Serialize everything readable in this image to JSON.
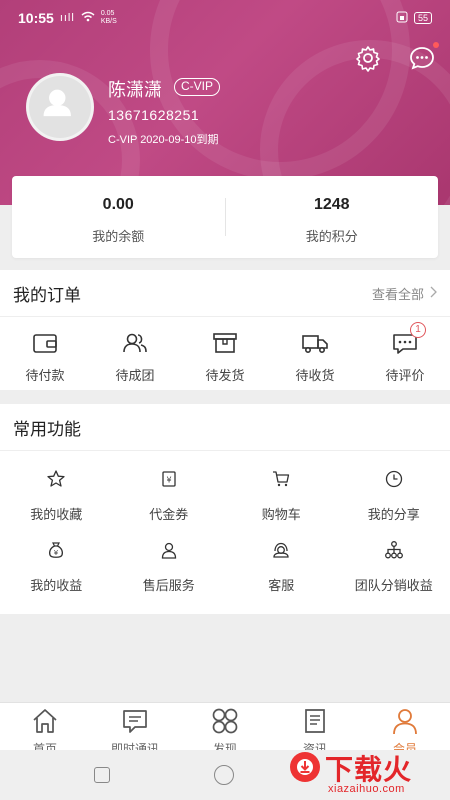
{
  "status_bar": {
    "time": "10:55",
    "signal": "ııll",
    "speed": "0.05\nKB/S",
    "battery": "55"
  },
  "profile": {
    "name": "陈潇潇",
    "vip_badge": "C-VIP",
    "phone": "13671628251",
    "expiry": "C-VIP 2020-09-10到期"
  },
  "balance": {
    "amount_value": "0.00",
    "amount_label": "我的余额",
    "points_value": "1248",
    "points_label": "我的积分"
  },
  "orders": {
    "title": "我的订单",
    "view_all": "查看全部",
    "items": [
      {
        "label": "待付款",
        "icon": "wallet-icon"
      },
      {
        "label": "待成团",
        "icon": "group-icon"
      },
      {
        "label": "待发货",
        "icon": "box-icon"
      },
      {
        "label": "待收货",
        "icon": "truck-icon"
      },
      {
        "label": "待评价",
        "icon": "comment-icon",
        "badge": "1"
      }
    ]
  },
  "functions": {
    "title": "常用功能",
    "items": [
      {
        "label": "我的收藏",
        "icon": "star-icon"
      },
      {
        "label": "代金券",
        "icon": "voucher-icon"
      },
      {
        "label": "购物车",
        "icon": "cart-icon"
      },
      {
        "label": "我的分享",
        "icon": "clock-icon"
      },
      {
        "label": "我的收益",
        "icon": "money-bag-icon"
      },
      {
        "label": "售后服务",
        "icon": "person-icon"
      },
      {
        "label": "客服",
        "icon": "headset-icon"
      },
      {
        "label": "团队分销收益",
        "icon": "team-tree-icon"
      }
    ]
  },
  "tabbar": {
    "items": [
      {
        "label": "首页",
        "icon": "home-icon",
        "active": false
      },
      {
        "label": "即时通讯",
        "icon": "chat-icon",
        "active": false
      },
      {
        "label": "发现",
        "icon": "discover-icon",
        "active": false
      },
      {
        "label": "资讯",
        "icon": "news-icon",
        "active": false
      },
      {
        "label": "会员",
        "icon": "member-icon",
        "active": true
      }
    ]
  },
  "watermark": {
    "brand": "下载火",
    "domain": "xiazaihuo.com"
  },
  "colors": {
    "header": "#b23f79",
    "accent": "#e07a3a",
    "badge": "#e0565b"
  }
}
